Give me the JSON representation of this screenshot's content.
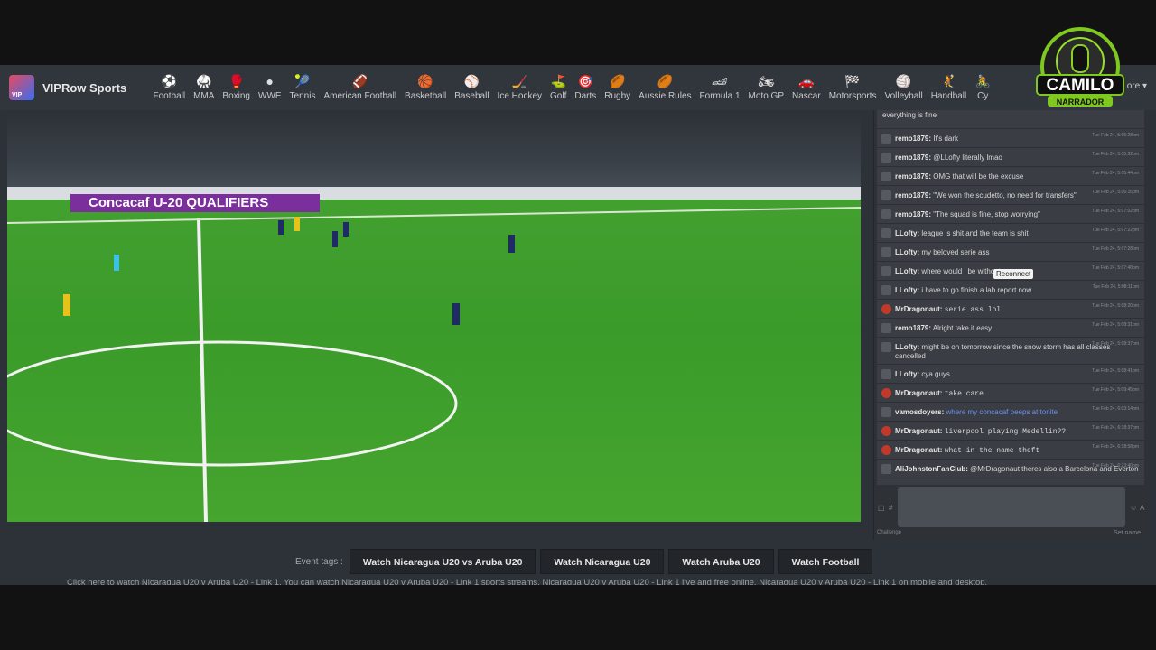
{
  "brand": {
    "name": "VIPRow Sports"
  },
  "nav": {
    "items": [
      {
        "label": "Football",
        "icon": "⚽"
      },
      {
        "label": "MMA",
        "icon": "🥋"
      },
      {
        "label": "Boxing",
        "icon": "🥊"
      },
      {
        "label": "WWE",
        "icon": "●"
      },
      {
        "label": "Tennis",
        "icon": "🎾"
      },
      {
        "label": "American Football",
        "icon": "🏈"
      },
      {
        "label": "Basketball",
        "icon": "🏀"
      },
      {
        "label": "Baseball",
        "icon": "⚾"
      },
      {
        "label": "Ice Hockey",
        "icon": "🏒"
      },
      {
        "label": "Golf",
        "icon": "⛳"
      },
      {
        "label": "Darts",
        "icon": "🎯"
      },
      {
        "label": "Rugby",
        "icon": "🏉"
      },
      {
        "label": "Aussie Rules",
        "icon": "🏉"
      },
      {
        "label": "Formula 1",
        "icon": "🏎"
      },
      {
        "label": "Moto GP",
        "icon": "🏍"
      },
      {
        "label": "Nascar",
        "icon": "🚗"
      },
      {
        "label": "Motorsports",
        "icon": "🏁"
      },
      {
        "label": "Volleyball",
        "icon": "🏐"
      },
      {
        "label": "Handball",
        "icon": "🤾"
      },
      {
        "label": "Cy",
        "icon": "🚴"
      }
    ],
    "more_label": "ore ▾"
  },
  "badge": {
    "line1": "CAMILO",
    "line2": "NARRADOR"
  },
  "video": {
    "banner": "Concacaf U-20 QUALIFIERS"
  },
  "chat": {
    "reconnect_label": "Reconnect",
    "messages": [
      {
        "user": "",
        "text": "everything is fine",
        "time": "",
        "avatar": "none",
        "style": ""
      },
      {
        "user": "remo1879:",
        "text": "It's dark",
        "time": "Tue Feb 24, 5:05:28pm",
        "avatar": "grey",
        "style": ""
      },
      {
        "user": "remo1879:",
        "text": "@LLofty literally lmao",
        "time": "Tue Feb 24, 5:05:32pm",
        "avatar": "grey",
        "style": ""
      },
      {
        "user": "remo1879:",
        "text": "OMG that will be the excuse",
        "time": "Tue Feb 24, 5:05:44pm",
        "avatar": "grey",
        "style": ""
      },
      {
        "user": "remo1879:",
        "text": "\"We won the scudetto, no need for transfers\"",
        "time": "Tue Feb 24, 5:06:16pm",
        "avatar": "grey",
        "style": ""
      },
      {
        "user": "remo1879:",
        "text": "\"The squad is fine, stop worrying\"",
        "time": "Tue Feb 24, 5:07:02pm",
        "avatar": "grey",
        "style": ""
      },
      {
        "user": "LLofty:",
        "text": "league is shit and the team is shit",
        "time": "Tue Feb 24, 5:07:22pm",
        "avatar": "grey",
        "style": ""
      },
      {
        "user": "LLofty:",
        "text": "my beloved serie ass",
        "time": "Tue Feb 24, 5:07:28pm",
        "avatar": "grey",
        "style": ""
      },
      {
        "user": "LLofty:",
        "text": "where would i be without",
        "time": "Tue Feb 24, 5:07:48pm",
        "avatar": "grey",
        "style": ""
      },
      {
        "user": "LLofty:",
        "text": "i have to go finish a lab report now",
        "time": "Tue Feb 24, 5:08:11pm",
        "avatar": "grey",
        "style": ""
      },
      {
        "user": "MrDragonaut:",
        "text": "serie ass lol",
        "time": "Tue Feb 24, 5:08:20pm",
        "avatar": "red",
        "style": "mono"
      },
      {
        "user": "remo1879:",
        "text": "Alright take it easy",
        "time": "Tue Feb 24, 5:08:31pm",
        "avatar": "grey",
        "style": ""
      },
      {
        "user": "LLofty:",
        "text": "might be on tomorrow since the snow storm has all classes cancelled",
        "time": "Tue Feb 24, 5:08:37pm",
        "avatar": "grey",
        "style": ""
      },
      {
        "user": "LLofty:",
        "text": "cya guys",
        "time": "Tue Feb 24, 5:08:41pm",
        "avatar": "grey",
        "style": ""
      },
      {
        "user": "MrDragonaut:",
        "text": "take care",
        "time": "Tue Feb 24, 5:09:45pm",
        "avatar": "red",
        "style": "mono"
      },
      {
        "user": "vamosdoyers:",
        "text": "where my concacaf peeps at tonite",
        "time": "Tue Feb 24, 6:03:14pm",
        "avatar": "grey",
        "style": "blue"
      },
      {
        "user": "MrDragonaut:",
        "text": "liverpool playing Medellin??",
        "time": "Tue Feb 24, 6:18:37pm",
        "avatar": "red",
        "style": "mono"
      },
      {
        "user": "MrDragonaut:",
        "text": "what in the name theft",
        "time": "Tue Feb 24, 6:18:58pm",
        "avatar": "red",
        "style": "mono"
      },
      {
        "user": "AliJohnstonFanClub:",
        "text": "@MrDragonaut theres also a Barcelona and Everton",
        "time": "Tue Feb 24, 6:23:40pm",
        "avatar": "grey",
        "style": ""
      }
    ],
    "footer_left": "Challenge",
    "footer_right": "Set name"
  },
  "tags": {
    "label": "Event tags :",
    "buttons": [
      "Watch Nicaragua U20 vs Aruba U20",
      "Watch Nicaragua U20",
      "Watch Aruba U20",
      "Watch Football"
    ]
  },
  "footer_text": "Click here to watch Nicaragua U20 v Aruba U20 - Link 1. You can watch Nicaragua U20 v Aruba U20 - Link 1 sports streams. Nicaragua U20 v Aruba U20 - Link 1 live and free online. Nicaragua U20 v Aruba U20 - Link 1 on mobile and desktop."
}
